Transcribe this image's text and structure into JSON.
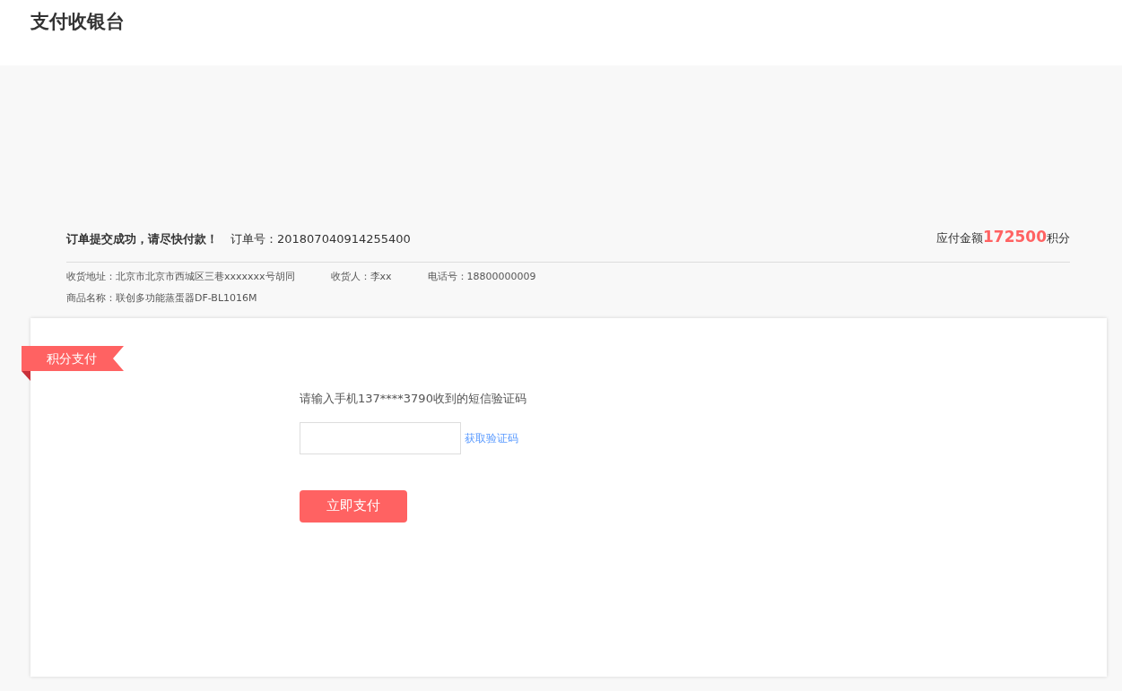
{
  "header": {
    "title": "支付收银台"
  },
  "order": {
    "notice": "订单提交成功，请尽快付款！",
    "order_no": "订单号：201807040914255400",
    "amount_label": "应付金额",
    "amount": "172500",
    "amount_unit": "积分",
    "details": [
      {
        "label": "收货地址：",
        "value": "北京市北京市西城区三巷xxxxxxx号胡同"
      },
      {
        "label": "收货人：",
        "value": "李xx"
      },
      {
        "label": "电话号：",
        "value": "18800000009"
      }
    ],
    "product": {
      "label": "商品名称：",
      "value": "联创多功能蒸蛋器DF-BL1016M"
    }
  },
  "payment": {
    "ribbon": "积分支付",
    "prompt": "请输入手机137****3790收到的短信验证码",
    "get_code_link": "获取验证码",
    "pay_button": "立即支付"
  }
}
